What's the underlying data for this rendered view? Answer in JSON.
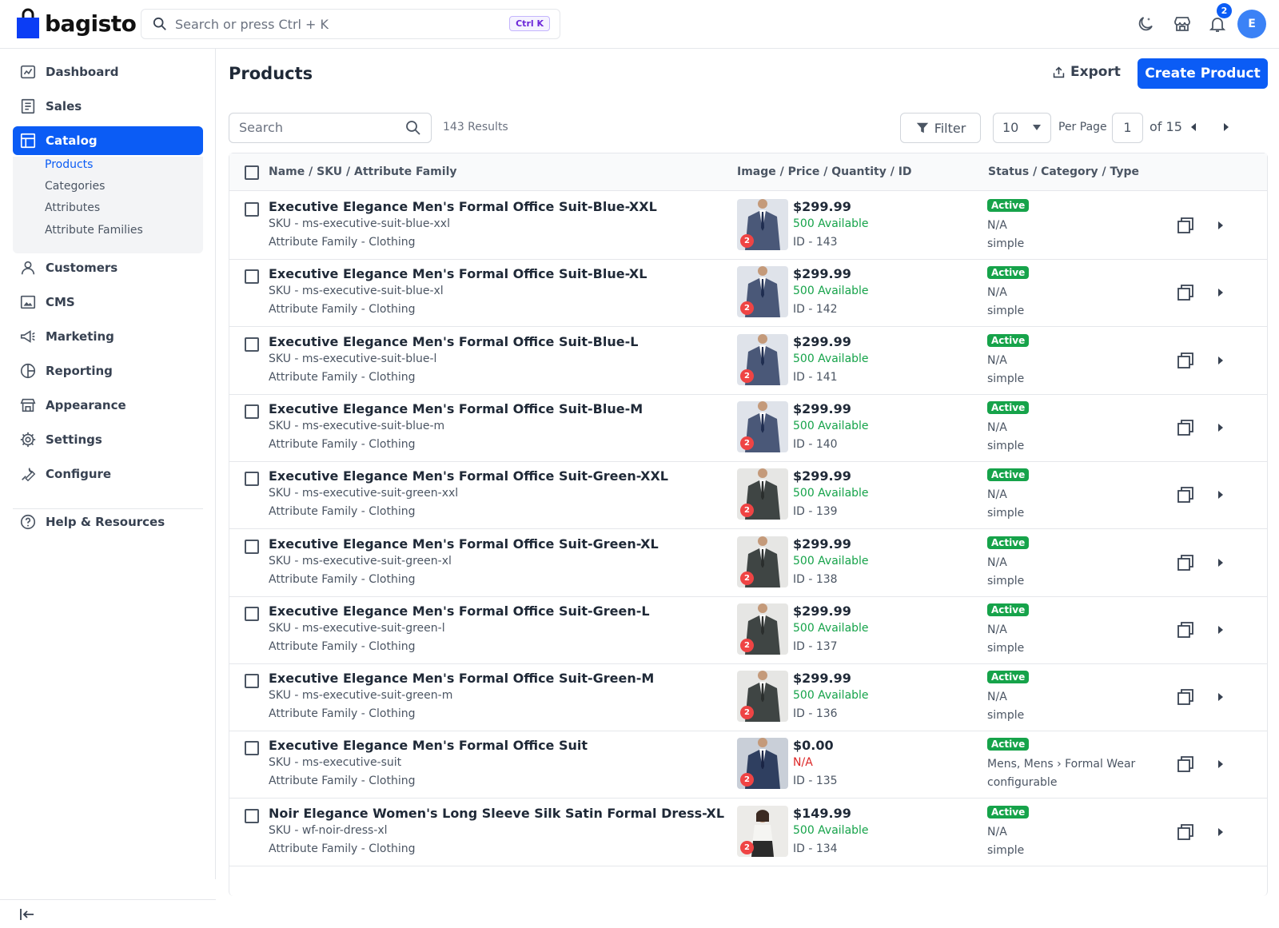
{
  "brand": {
    "name": "bagisto"
  },
  "search": {
    "placeholder": "Search or press Ctrl + K",
    "shortcut": "Ctrl K"
  },
  "topbar": {
    "notification_count": "2",
    "avatar_initial": "E",
    "accent": "#0b5cf5"
  },
  "sidebar": {
    "items": [
      {
        "label": "Dashboard",
        "icon": "dashboard-icon"
      },
      {
        "label": "Sales",
        "icon": "sales-icon"
      },
      {
        "label": "Catalog",
        "icon": "catalog-icon"
      },
      {
        "label": "Customers",
        "icon": "customers-icon"
      },
      {
        "label": "CMS",
        "icon": "cms-icon"
      },
      {
        "label": "Marketing",
        "icon": "marketing-icon"
      },
      {
        "label": "Reporting",
        "icon": "reporting-icon"
      },
      {
        "label": "Appearance",
        "icon": "appearance-icon"
      },
      {
        "label": "Settings",
        "icon": "settings-icon"
      },
      {
        "label": "Configure",
        "icon": "configure-icon"
      },
      {
        "label": "Help & Resources",
        "icon": "help-icon"
      }
    ],
    "catalog_sub": [
      {
        "label": "Products"
      },
      {
        "label": "Categories"
      },
      {
        "label": "Attributes"
      },
      {
        "label": "Attribute Families"
      }
    ]
  },
  "main": {
    "title": "Products",
    "export_label": "Export",
    "create_label": "Create Product",
    "search_placeholder": "Search",
    "results": "143 Results",
    "filter_label": "Filter",
    "per_page_value": "10",
    "per_page_label": "Per Page",
    "page": "1",
    "of_pages": "of 15"
  },
  "table": {
    "headers": [
      "Name / SKU / Attribute Family",
      "Image / Price / Quantity / ID",
      "Status / Category / Type"
    ],
    "rows": [
      {
        "name": "Executive Elegance Men's Formal Office Suit-Blue-XXL",
        "sku": "SKU - ms-executive-suit-blue-xxl",
        "family": "Attribute Family - Clothing",
        "price": "$299.99",
        "qty": "500 Available",
        "id": "ID - 143",
        "status": "Active",
        "category": "N/A",
        "type": "simple",
        "images": "2",
        "color": "blue"
      },
      {
        "name": "Executive Elegance Men's Formal Office Suit-Blue-XL",
        "sku": "SKU - ms-executive-suit-blue-xl",
        "family": "Attribute Family - Clothing",
        "price": "$299.99",
        "qty": "500 Available",
        "id": "ID - 142",
        "status": "Active",
        "category": "N/A",
        "type": "simple",
        "images": "2",
        "color": "blue"
      },
      {
        "name": "Executive Elegance Men's Formal Office Suit-Blue-L",
        "sku": "SKU - ms-executive-suit-blue-l",
        "family": "Attribute Family - Clothing",
        "price": "$299.99",
        "qty": "500 Available",
        "id": "ID - 141",
        "status": "Active",
        "category": "N/A",
        "type": "simple",
        "images": "2",
        "color": "blue"
      },
      {
        "name": "Executive Elegance Men's Formal Office Suit-Blue-M",
        "sku": "SKU - ms-executive-suit-blue-m",
        "family": "Attribute Family - Clothing",
        "price": "$299.99",
        "qty": "500 Available",
        "id": "ID - 140",
        "status": "Active",
        "category": "N/A",
        "type": "simple",
        "images": "2",
        "color": "blue"
      },
      {
        "name": "Executive Elegance Men's Formal Office Suit-Green-XXL",
        "sku": "SKU - ms-executive-suit-green-xxl",
        "family": "Attribute Family - Clothing",
        "price": "$299.99",
        "qty": "500 Available",
        "id": "ID - 139",
        "status": "Active",
        "category": "N/A",
        "type": "simple",
        "images": "2",
        "color": "green"
      },
      {
        "name": "Executive Elegance Men's Formal Office Suit-Green-XL",
        "sku": "SKU - ms-executive-suit-green-xl",
        "family": "Attribute Family - Clothing",
        "price": "$299.99",
        "qty": "500 Available",
        "id": "ID - 138",
        "status": "Active",
        "category": "N/A",
        "type": "simple",
        "images": "2",
        "color": "green"
      },
      {
        "name": "Executive Elegance Men's Formal Office Suit-Green-L",
        "sku": "SKU - ms-executive-suit-green-l",
        "family": "Attribute Family - Clothing",
        "price": "$299.99",
        "qty": "500 Available",
        "id": "ID - 137",
        "status": "Active",
        "category": "N/A",
        "type": "simple",
        "images": "2",
        "color": "green"
      },
      {
        "name": "Executive Elegance Men's Formal Office Suit-Green-M",
        "sku": "SKU - ms-executive-suit-green-m",
        "family": "Attribute Family - Clothing",
        "price": "$299.99",
        "qty": "500 Available",
        "id": "ID - 136",
        "status": "Active",
        "category": "N/A",
        "type": "simple",
        "images": "2",
        "color": "green"
      },
      {
        "name": "Executive Elegance Men's Formal Office Suit",
        "sku": "SKU - ms-executive-suit",
        "family": "Attribute Family - Clothing",
        "price": "$0.00",
        "qty": "N/A",
        "id": "ID - 135",
        "status": "Active",
        "category": "Mens, Mens › Formal Wear",
        "type": "configurable",
        "images": "2",
        "color": "navy"
      },
      {
        "name": "Noir Elegance Women's Long Sleeve Silk Satin Formal Dress-XL",
        "sku": "SKU - wf-noir-dress-xl",
        "family": "Attribute Family - Clothing",
        "price": "$149.99",
        "qty": "500 Available",
        "id": "ID - 134",
        "status": "Active",
        "category": "N/A",
        "type": "simple",
        "images": "2",
        "color": "dress"
      }
    ]
  }
}
